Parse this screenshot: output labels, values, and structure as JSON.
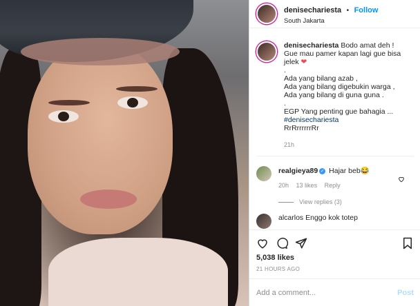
{
  "header": {
    "username": "denisechariesta",
    "separator": "•",
    "follow_label": "Follow",
    "location": "South Jakarta"
  },
  "caption": {
    "username": "denisechariesta",
    "lines": [
      "Bodo amat deh !",
      "Gue mau pamer kapan lagi gue bisa",
      "jelek",
      ".",
      "Ada yang bilang azab ,",
      "Ada yang bilang digebukin warga ,",
      "Ada yang bilang di guna guna .",
      ".",
      "EGP Yang penting gue bahagia ..."
    ],
    "heart_emoji": "❤",
    "hashtag": "#denisechariesta",
    "last_line": "RrRrrrrrrRr",
    "time": "21h"
  },
  "reply": {
    "username": "realgieya89",
    "verified_mark": "✓",
    "text": "Hajar beb😂",
    "time": "20h",
    "likes": "13 likes",
    "reply_label": "Reply",
    "view_replies": "View replies (3)",
    "partial_next": "alcarlos Enggo kok totep"
  },
  "actions": {
    "likes": "5,038 likes",
    "time_ago": "21 HOURS AGO"
  },
  "comment_box": {
    "placeholder": "Add a comment...",
    "post_label": "Post"
  },
  "colors": {
    "link_blue": "#0095f6",
    "post_disabled": "#b2dffc",
    "hashtag": "#00376b",
    "heart_red": "#ed4956"
  }
}
